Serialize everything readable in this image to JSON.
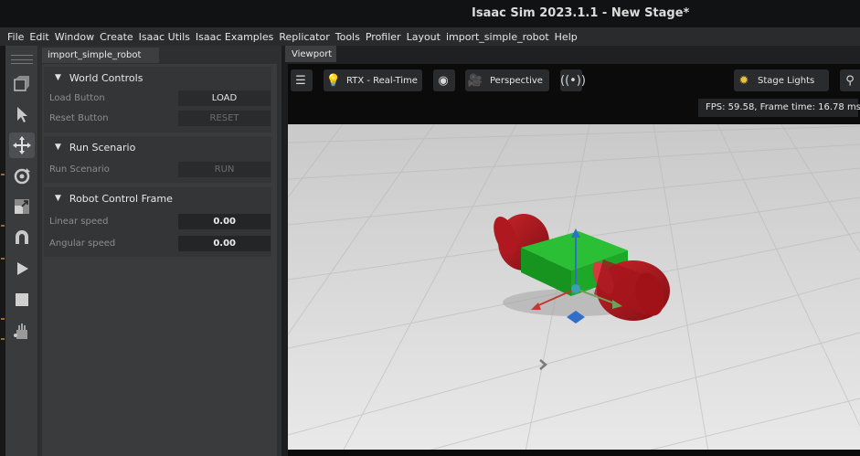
{
  "window": {
    "title": "Isaac Sim 2023.1.1 - New Stage*"
  },
  "menu": [
    "File",
    "Edit",
    "Window",
    "Create",
    "Isaac Utils",
    "Isaac Examples",
    "Replicator",
    "Tools",
    "Profiler",
    "Layout",
    "import_simple_robot",
    "Help"
  ],
  "toolbar": {
    "tools": [
      {
        "name": "select-mode-icon",
        "glyph": "▣"
      },
      {
        "name": "pointer-icon",
        "glyph": "➤"
      },
      {
        "name": "move-icon",
        "glyph": "✥"
      },
      {
        "name": "rotate-icon",
        "glyph": "⟳"
      },
      {
        "name": "scale-icon",
        "glyph": "⤡"
      },
      {
        "name": "snap-magnet-icon",
        "glyph": "∩"
      },
      {
        "name": "play-icon",
        "glyph": "▶"
      },
      {
        "name": "stop-icon",
        "glyph": "■"
      },
      {
        "name": "physics-tools-icon",
        "glyph": "⚙"
      }
    ]
  },
  "panel": {
    "tab": "import_simple_robot",
    "world_controls": {
      "header": "World Controls",
      "load_label": "Load Button",
      "load_button": "LOAD",
      "reset_label": "Reset Button",
      "reset_button": "RESET"
    },
    "run_scenario": {
      "header": "Run Scenario",
      "run_label": "Run Scenario",
      "run_button": "RUN"
    },
    "robot_control": {
      "header": "Robot Control Frame",
      "linear_label": "Linear speed",
      "linear_value": "0.00",
      "angular_label": "Angular speed",
      "angular_value": "0.00"
    }
  },
  "viewport": {
    "tab": "Viewport",
    "renderer": "RTX - Real-Time",
    "camera": "Perspective",
    "lighting": "Stage Lights",
    "fps": "FPS: 59.58, Frame time: 16.78 ms"
  },
  "colors": {
    "robot_body": "#1fa32a",
    "wheel": "#b0161d",
    "gizmo_y": "#2f6fc9",
    "gizmo_x": "#c03a32",
    "gizmo_z": "#6aa45a"
  }
}
